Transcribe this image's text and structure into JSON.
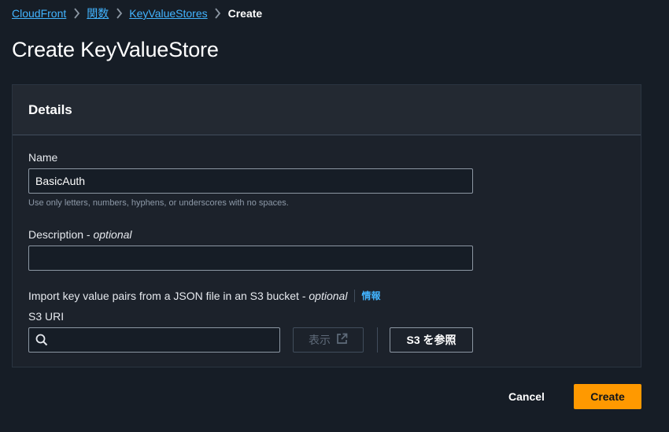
{
  "breadcrumb": {
    "items": [
      "CloudFront",
      "関数",
      "KeyValueStores"
    ],
    "current": "Create"
  },
  "page": {
    "title": "Create KeyValueStore"
  },
  "panel": {
    "title": "Details"
  },
  "name_field": {
    "label": "Name",
    "value": "BasicAuth",
    "hint": "Use only letters, numbers, hyphens, or underscores with no spaces."
  },
  "description_field": {
    "label": "Description",
    "optional": "optional",
    "value": ""
  },
  "import": {
    "label": "Import key value pairs from a JSON file in an S3 bucket",
    "optional": "optional",
    "info_link": "情報",
    "s3_uri_label": "S3 URI",
    "s3_uri_value": "",
    "view_button": "表示",
    "browse_button": "S3 を参照"
  },
  "footer": {
    "cancel_label": "Cancel",
    "create_label": "Create"
  },
  "colors": {
    "background": "#161d26",
    "panel": "#1c222b",
    "link": "#42b4ff",
    "primary_button": "#ff9900"
  },
  "icons": {
    "breadcrumb_separator": "chevron-right-icon",
    "search": "search-icon",
    "external_link": "external-link-icon"
  }
}
